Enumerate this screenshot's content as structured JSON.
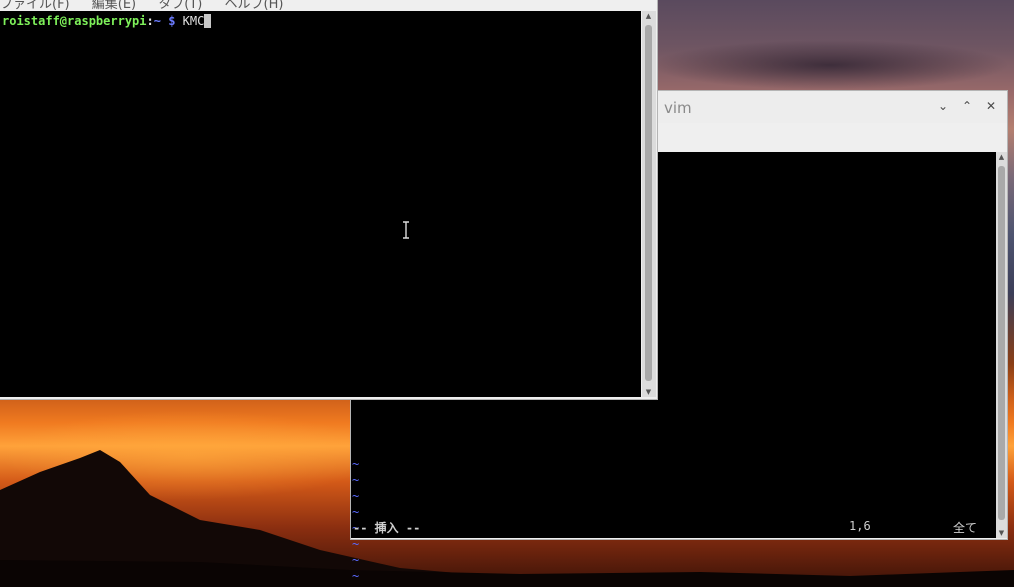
{
  "desktop": {
    "accent": "#f07a20"
  },
  "terminal_window": {
    "menu_items": [
      "ファイル(F)",
      "編集(E)",
      "タブ(T)",
      "ヘルプ(H)"
    ],
    "prompt_user": "roistaff@raspberrypi",
    "prompt_sep": ":",
    "prompt_path": "~",
    "prompt_symbol": "$",
    "command_text": "KMC",
    "colors": {
      "user": "#7ef05a",
      "path": "#6c7cff",
      "background": "#000000"
    }
  },
  "vim_window": {
    "title": "vim",
    "menu_fragment": ")",
    "controls": {
      "minimize": "⌄",
      "maximize": "⌃",
      "close": "✕"
    },
    "tilde_lines": [
      "~",
      "~",
      "~",
      "~",
      "~",
      "~",
      "~",
      "~"
    ],
    "status": {
      "mode": "-- 挿入 --",
      "position": "1,6",
      "scroll": "全て"
    },
    "colors": {
      "tilde": "#5a6aff"
    }
  }
}
